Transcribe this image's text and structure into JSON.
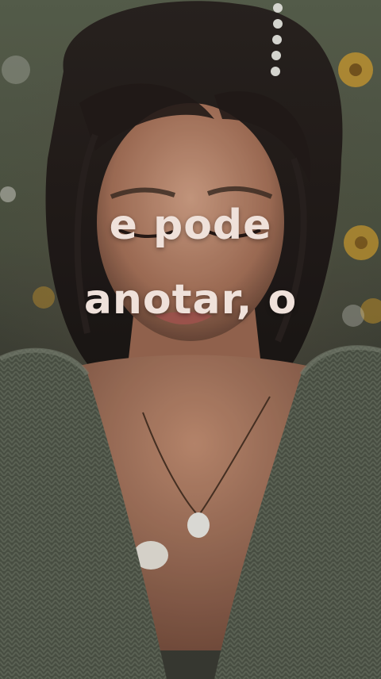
{
  "caption": {
    "line1": "e pode",
    "line2": "anotar, o"
  },
  "scene": {
    "icon": "woman-portrait-photo",
    "accent_colors": {
      "hair": "#2a2220",
      "skin": "#c8957a",
      "sweater": "#4f5548",
      "flowers": "#d9a431",
      "caption": "#efe1da"
    }
  }
}
